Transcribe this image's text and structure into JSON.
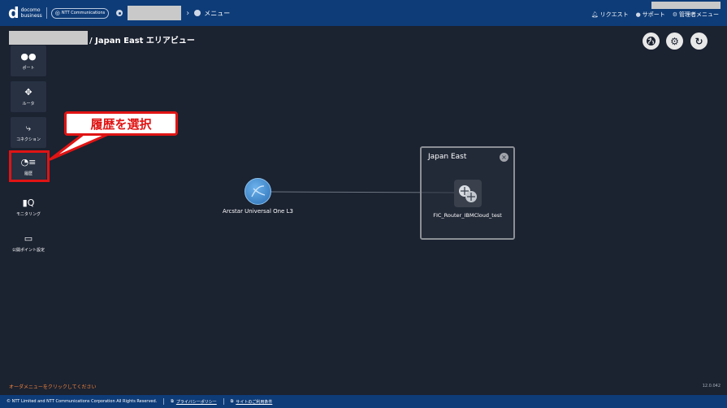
{
  "header": {
    "logo_mark": "d",
    "logo_line1": "docomo",
    "logo_line2": "business",
    "partner_badge": "NTT Communications",
    "menu_label": "メニュー",
    "actions": [
      {
        "icon": "bell-icon",
        "label": "リクエスト"
      },
      {
        "icon": "help-icon",
        "label": "サポート"
      },
      {
        "icon": "gear-icon",
        "label": "管理者メニュー"
      }
    ]
  },
  "page": {
    "title": "/ Japan East エリアビュー"
  },
  "sidebar": {
    "items": [
      {
        "name": "port",
        "icon": "port-icon",
        "label": "ポート"
      },
      {
        "name": "router",
        "icon": "router-icon",
        "label": "ルータ"
      },
      {
        "name": "connection",
        "icon": "connection-icon",
        "label": "コネクション"
      },
      {
        "name": "history",
        "icon": "history-icon",
        "label": "履歴"
      },
      {
        "name": "monitoring",
        "icon": "monitoring-icon",
        "label": "モニタリング"
      },
      {
        "name": "public-point",
        "icon": "monitor-icon",
        "label": "公開ポイント設定"
      }
    ]
  },
  "annotation": {
    "callout_text": "履歴を選択",
    "color": "#e01414"
  },
  "map": {
    "external_node_label": "Arcstar Universal One L3",
    "area_title": "Japan East",
    "router_label": "FIC_Router_IBMCloud_test"
  },
  "status": {
    "order_message": "オーダメニューをクリックしてください",
    "version": "12.0.042"
  },
  "footer": {
    "copyright": "© NTT Limited and NTT Communications Corporation All Rights Reserved.",
    "privacy_link": "プライバシーポリシー",
    "terms_link": "サイトのご利用条件"
  },
  "colors": {
    "background": "#1b2230",
    "header": "#0e3c78",
    "accent_orange": "#f0843c"
  }
}
